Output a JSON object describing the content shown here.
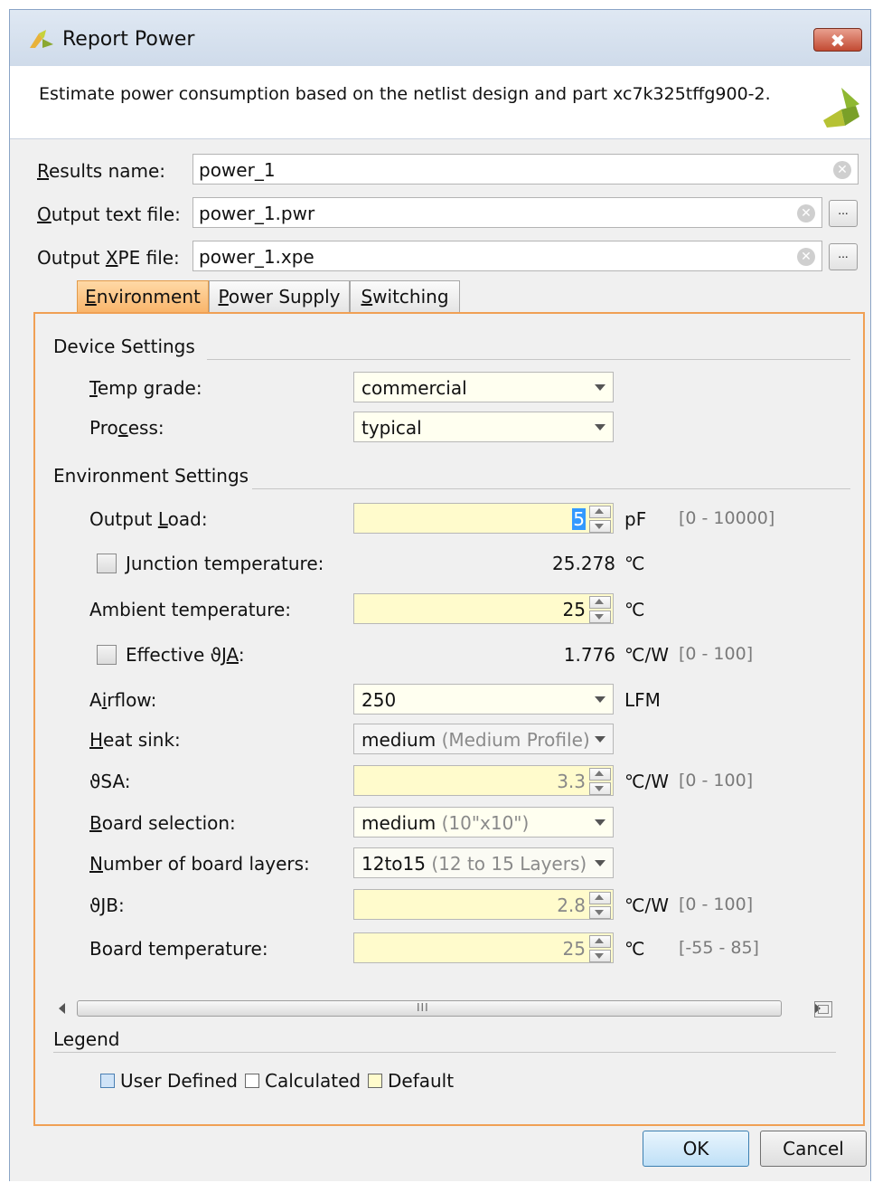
{
  "window": {
    "title": "Report Power",
    "close_label": "✖"
  },
  "header": {
    "description": "Estimate power consumption based on the netlist design and part xc7k325tffg900-2."
  },
  "form": {
    "results_name": {
      "label_first": "R",
      "label_rest": "esults name:",
      "value": "power_1"
    },
    "output_text_file": {
      "label_first": "O",
      "label_rest": "utput text file:",
      "value": "power_1.pwr"
    },
    "output_xpe_file": {
      "label_pre": "Output ",
      "label_u": "X",
      "label_rest": "PE file:",
      "value": "power_1.xpe"
    },
    "browse_label": "..."
  },
  "tabs": [
    {
      "first": "E",
      "rest": "nvironment",
      "active": true
    },
    {
      "first": "P",
      "rest": "ower Supply",
      "active": false
    },
    {
      "first": "S",
      "rest": "witching",
      "active": false
    }
  ],
  "device_settings": {
    "title": "Device Settings",
    "temp_grade": {
      "first": "T",
      "rest": "emp grade:",
      "value": "commercial"
    },
    "process": {
      "pre": "Pro",
      "u": "c",
      "rest": "ess:",
      "value": "typical"
    }
  },
  "environment_settings": {
    "title": "Environment Settings",
    "output_load": {
      "pre": "Output ",
      "u": "L",
      "rest": "oad:",
      "value": "5",
      "unit": "pF",
      "range": "[0 - 10000]"
    },
    "junction_temperature": {
      "u": "J",
      "rest": "unction temperature:",
      "value": "25.278",
      "unit": "℃",
      "checked": false
    },
    "ambient_temperature": {
      "label": "Ambient temperature:",
      "value": "25",
      "unit": "℃"
    },
    "effective_theta_ja": {
      "pre": "Effective ϑJ",
      "u": "A",
      "rest": ":",
      "value": "1.776",
      "unit": "℃/W",
      "range": "[0 - 100]",
      "checked": false
    },
    "airflow": {
      "pre": "A",
      "u": "i",
      "rest": "rflow:",
      "value": "250",
      "unit": "LFM"
    },
    "heat_sink": {
      "u": "H",
      "rest": "eat sink:",
      "value": "medium",
      "hint": "(Medium Profile)"
    },
    "theta_sa": {
      "label": "ϑSA:",
      "value": "3.3",
      "unit": "℃/W",
      "range": "[0 - 100]"
    },
    "board_selection": {
      "u": "B",
      "rest": "oard selection:",
      "value": "medium",
      "hint": "(10\"x10\")"
    },
    "board_layers": {
      "u": "N",
      "rest": "umber of board layers:",
      "value": "12to15",
      "hint": "(12 to 15 Layers)"
    },
    "theta_jb": {
      "label": "ϑJB:",
      "value": "2.8",
      "unit": "℃/W",
      "range": "[0 - 100]"
    },
    "board_temperature": {
      "label": "Board temperature:",
      "value": "25",
      "unit": "℃",
      "range": "[-55 - 85]"
    }
  },
  "scrollbar": {
    "grip": "III"
  },
  "legend": {
    "title": "Legend",
    "items": [
      {
        "label": "User Defined",
        "color": "#cfe3f7"
      },
      {
        "label": "Calculated",
        "color": "#ffffff"
      },
      {
        "label": "Default",
        "color": "#fffbcc"
      }
    ]
  },
  "buttons": {
    "ok": "OK",
    "cancel": "Cancel"
  }
}
